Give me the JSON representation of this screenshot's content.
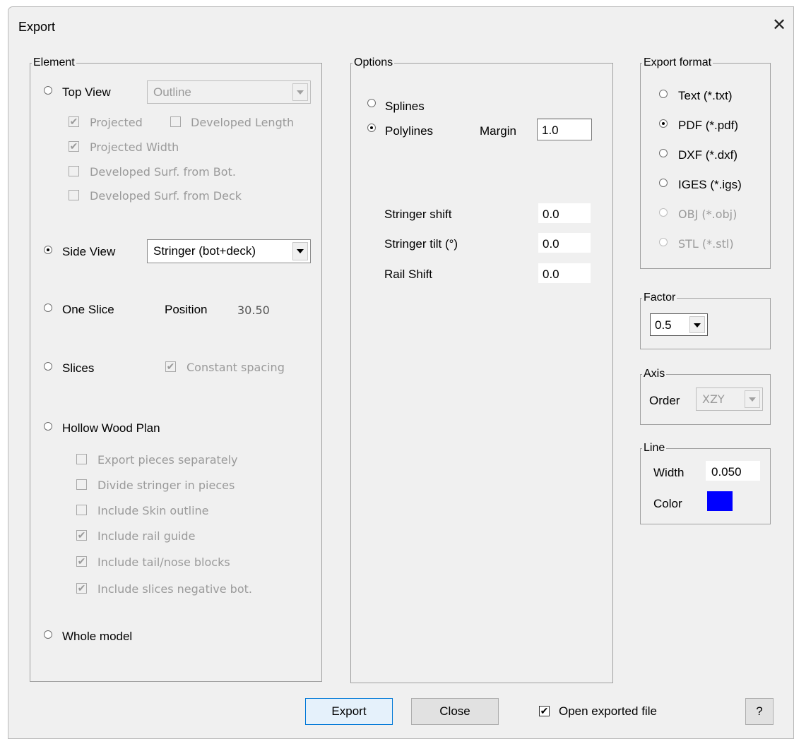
{
  "window": {
    "title": "Export",
    "close_label": "✕"
  },
  "element": {
    "legend": "Element",
    "top_view": {
      "label": "Top View",
      "combo_value": "Outline",
      "checked": false
    },
    "top_checks": [
      {
        "label": "Projected",
        "checked": true
      },
      {
        "label": "Developed Length",
        "checked": false
      },
      {
        "label": "Projected Width",
        "checked": true
      },
      {
        "label": "Developed Surf. from Bot.",
        "checked": false
      },
      {
        "label": "Developed Surf. from Deck",
        "checked": false
      }
    ],
    "side_view": {
      "label": "Side View",
      "combo_value": "Stringer (bot+deck)",
      "checked": true
    },
    "one_slice": {
      "label": "One Slice",
      "position_label": "Position",
      "position_value": "30.50",
      "checked": false
    },
    "slices": {
      "label": "Slices",
      "constant_spacing": "Constant spacing",
      "constant_checked": true,
      "checked": false
    },
    "hollow_wood": {
      "label": "Hollow Wood Plan",
      "checked": false
    },
    "hollow_checks": [
      {
        "label": "Export pieces separately",
        "checked": false
      },
      {
        "label": "Divide stringer in pieces",
        "checked": false
      },
      {
        "label": "Include Skin outline",
        "checked": false
      },
      {
        "label": "Include rail guide",
        "checked": true
      },
      {
        "label": "Include tail/nose blocks",
        "checked": true
      },
      {
        "label": "Include slices negative bot.",
        "checked": true
      }
    ],
    "whole_model": {
      "label": "Whole model",
      "checked": false
    }
  },
  "options": {
    "legend": "Options",
    "splines": {
      "label": "Splines",
      "checked": false
    },
    "polylines": {
      "label": "Polylines",
      "checked": true
    },
    "margin_label": "Margin",
    "margin_value": "1.0",
    "stringer_shift_label": "Stringer shift",
    "stringer_shift_value": "0.0",
    "stringer_tilt_label": "Stringer tilt (°)",
    "stringer_tilt_value": "0.0",
    "rail_shift_label": "Rail Shift",
    "rail_shift_value": "0.0"
  },
  "export_format": {
    "legend": "Export format",
    "items": [
      {
        "label": "Text (*.txt)",
        "checked": false,
        "enabled": true
      },
      {
        "label": "PDF (*.pdf)",
        "checked": true,
        "enabled": true
      },
      {
        "label": "DXF (*.dxf)",
        "checked": false,
        "enabled": true
      },
      {
        "label": "IGES (*.igs)",
        "checked": false,
        "enabled": true
      },
      {
        "label": "OBJ (*.obj)",
        "checked": false,
        "enabled": false
      },
      {
        "label": "STL (*.stl)",
        "checked": false,
        "enabled": false
      }
    ]
  },
  "factor": {
    "legend": "Factor",
    "value": "0.5"
  },
  "axis": {
    "legend": "Axis",
    "order_label": "Order",
    "order_value": "XZY"
  },
  "line": {
    "legend": "Line",
    "width_label": "Width",
    "width_value": "0.050",
    "color_label": "Color",
    "color": "#0000ff"
  },
  "footer": {
    "export_button": "Export",
    "close_button": "Close",
    "open_exported_label": "Open exported file",
    "open_exported_checked": true,
    "help_button": "?"
  }
}
